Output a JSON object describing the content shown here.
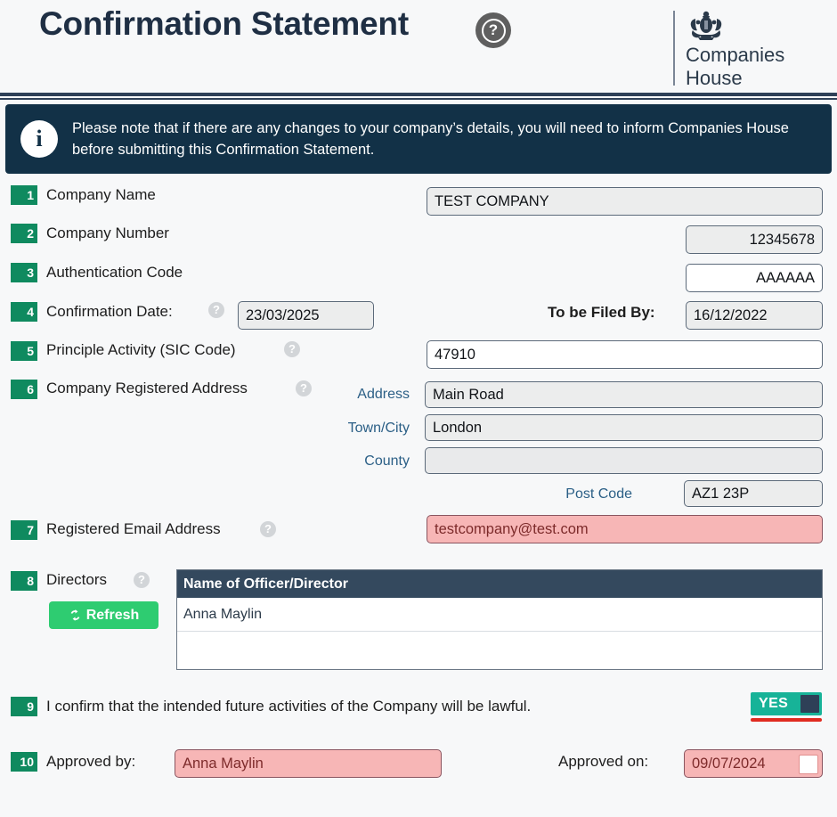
{
  "window": {
    "collapse_tab_icon": "double-chevron-right",
    "collapse_tab_label": "»"
  },
  "header": {
    "title": "Confirmation Statement",
    "help_icon": "question-mark-circle-icon",
    "help_glyph": "?",
    "brand": {
      "crest_icon": "royal-coat-of-arms-icon",
      "line1": "Companies",
      "line2": "House"
    }
  },
  "banner": {
    "icon": "info-icon",
    "icon_glyph": "i",
    "text": "Please note that if there are any changes to your company’s details, you will need to inform Companies House before submitting this Confirmation Statement."
  },
  "form": {
    "rows": [
      {
        "number": "1",
        "label": "Company Name",
        "value": "TEST COMPANY"
      },
      {
        "number": "2",
        "label": "Company Number",
        "value": "12345678"
      },
      {
        "number": "3",
        "label": "Authentication Code",
        "value": "AAAAAA"
      },
      {
        "number": "4",
        "label": "Confirmation Date:",
        "value": "23/03/2025"
      },
      {
        "number": "5",
        "label": "Principle Activity (SIC Code)",
        "value": "47910"
      },
      {
        "number": "6",
        "label": "Company Registered Address",
        "value": ""
      },
      {
        "number": "7",
        "label": "Registered Email Address",
        "value": "testcompany@test.com"
      },
      {
        "number": "8",
        "label": "Directors",
        "value": ""
      },
      {
        "number": "9",
        "label": "I confirm that the intended future activities of the Company will be lawful.",
        "value": "YES"
      },
      {
        "number": "10",
        "label": "Approved by:",
        "value": "Anna Maylin"
      }
    ],
    "filed_by": {
      "label": "To be Filed By:",
      "value": "16/12/2022"
    },
    "address": {
      "address_label": "Address",
      "address_value": "Main Road",
      "town_label": "Town/City",
      "town_value": "London",
      "county_label": "County",
      "county_value": "",
      "postcode_label": "Post Code",
      "postcode_value": "AZ1 23P"
    },
    "directors": {
      "refresh_label": "Refresh",
      "refresh_icon": "refresh-circular-arrows-icon",
      "column_header": "Name of Officer/Director",
      "rows": [
        "Anna Maylin",
        ""
      ]
    },
    "confirm_toggle": {
      "state_label": "YES",
      "accent_color": "#17b398",
      "underline_color": "#e02b20"
    },
    "approved_on": {
      "label": "Approved on:",
      "value": "09/07/2024",
      "calendar_icon": "calendar-icon"
    }
  },
  "theme": {
    "badge_green": "#0f8a5f",
    "navy": "#2e4057",
    "banner_navy": "#123147",
    "error_pink": "#f7b6b6",
    "refresh_green": "#2ecc71",
    "sub_label_blue": "#2b5f86"
  }
}
